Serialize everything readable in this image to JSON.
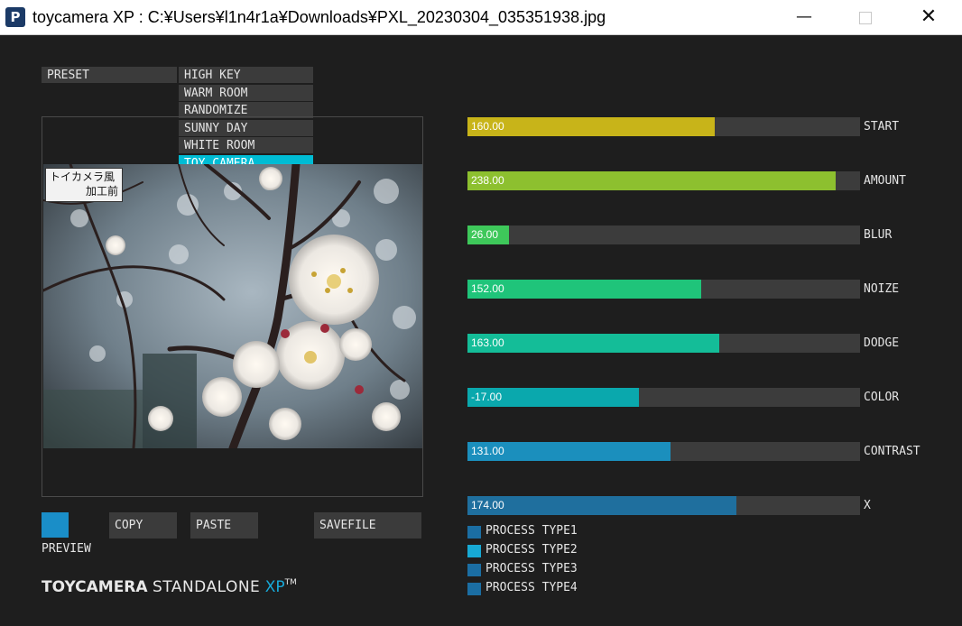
{
  "window": {
    "title": "toycamera XP : C:¥Users¥l1n4r1a¥Downloads¥PXL_20230304_035351938.jpg",
    "minimize": "—",
    "close": "✕"
  },
  "preset": {
    "label": "PRESET",
    "items": [
      "HIGH KEY",
      "WARM ROOM",
      "RANDOMIZE",
      "SUNNY DAY",
      "WHITE ROOM",
      "TOY CAMERA"
    ],
    "selected": "TOY CAMERA"
  },
  "photo_tag": {
    "line1": "トイカメラ風",
    "line2": "加工前"
  },
  "controls": {
    "preview_label": "PREVIEW",
    "copy": "COPY",
    "paste": "PASTE",
    "savefile": "SAVEFILE"
  },
  "brand": {
    "part1": "TOYCAMERA",
    "part2": "STANDALONE",
    "part3": "XP",
    "tm": "TM"
  },
  "sliders": [
    {
      "label": "START",
      "value": "160.00",
      "fill_fraction": 0.63,
      "color": "#c8b419"
    },
    {
      "label": "AMOUNT",
      "value": "238.00",
      "fill_fraction": 0.938,
      "color": "#8dc02f"
    },
    {
      "label": "BLUR",
      "value": "26.00",
      "fill_fraction": 0.105,
      "color": "#3ec85a"
    },
    {
      "label": "NOIZE",
      "value": "152.00",
      "fill_fraction": 0.596,
      "color": "#1fc47a"
    },
    {
      "label": "DODGE",
      "value": "163.00",
      "fill_fraction": 0.641,
      "color": "#14bd98"
    },
    {
      "label": "COLOR",
      "value": "-17.00",
      "fill_fraction": 0.437,
      "color": "#0aa8ad"
    },
    {
      "label": "CONTRAST",
      "value": "131.00",
      "fill_fraction": 0.517,
      "color": "#1b8fbd"
    },
    {
      "label": "X",
      "value": "174.00",
      "fill_fraction": 0.685,
      "color": "#1f6f9e"
    }
  ],
  "process_types": [
    {
      "label": "PROCESS TYPE1",
      "color": "#1b6ea3"
    },
    {
      "label": "PROCESS TYPE2",
      "color": "#17a9d4"
    },
    {
      "label": "PROCESS TYPE3",
      "color": "#1b6ea3"
    },
    {
      "label": "PROCESS TYPE4",
      "color": "#1b6ea3"
    }
  ],
  "colors": {
    "accent": "#00bcd4",
    "preview": "#1a8ec8"
  }
}
